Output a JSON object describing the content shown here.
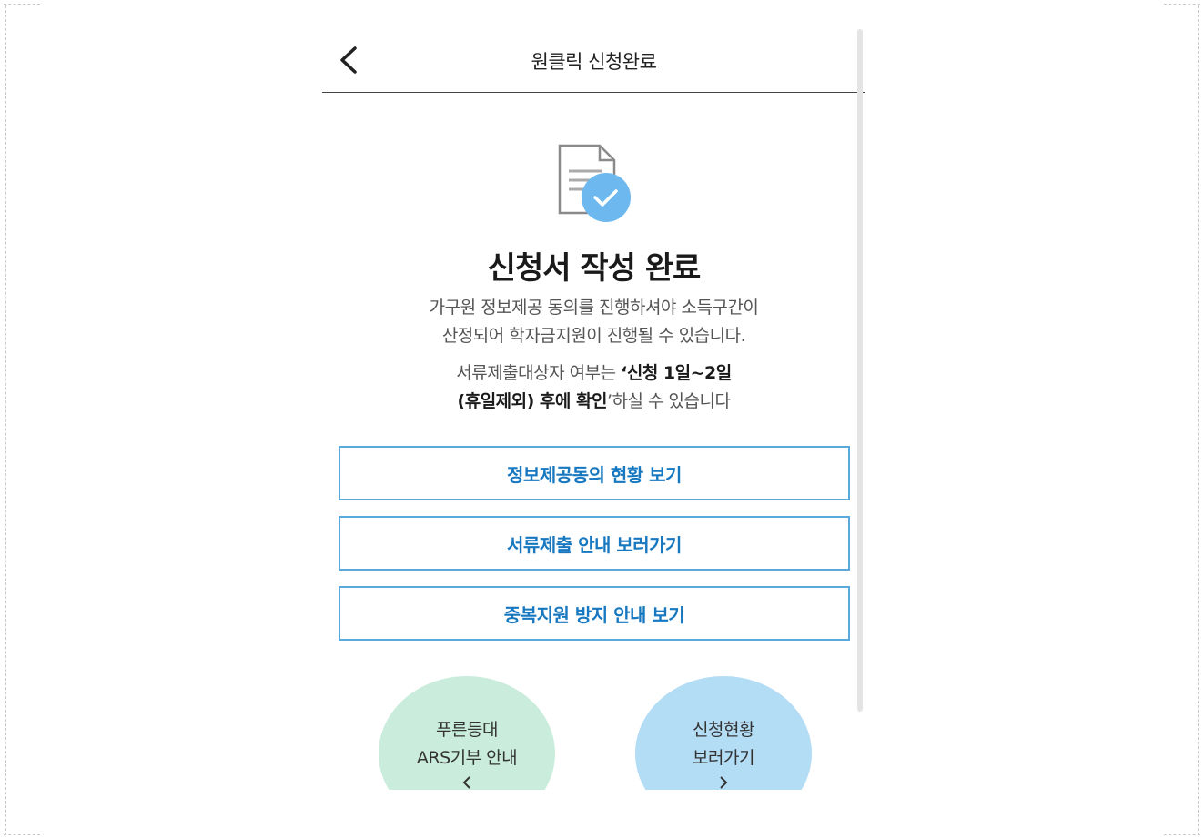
{
  "header": {
    "title": "원클릭 신청완료"
  },
  "main": {
    "heading": "신청서 작성 완료",
    "desc_line1": "가구원 정보제공 동의를 진행하셔야 소득구간이",
    "desc_line2": "산정되어 학자금지원이 진행될 수 있습니다.",
    "notice_prefix": "서류제출대상자 여부는 ",
    "notice_bold1": "‘신청 1일~2일",
    "notice_bold2": "(휴일제외) 후에 확인",
    "notice_suffix": "’하실 수 있습니다"
  },
  "buttons": {
    "consent_status": "정보제공동의 현황 보기",
    "document_guide": "서류제출 안내 보러가기",
    "duplicate_guide": "중복지원 방지 안내 보기"
  },
  "circles": {
    "ars": {
      "line1": "푸른등대",
      "line2": "ARS기부 안내"
    },
    "status": {
      "line1": "신청현황",
      "line2": "보러가기"
    }
  },
  "colors": {
    "accent_blue": "#1778c0",
    "button_border": "#5aa9dd",
    "check_badge": "#6db8ef",
    "circle_green": "#c9ecdc",
    "circle_blue": "#b3dcf5"
  }
}
